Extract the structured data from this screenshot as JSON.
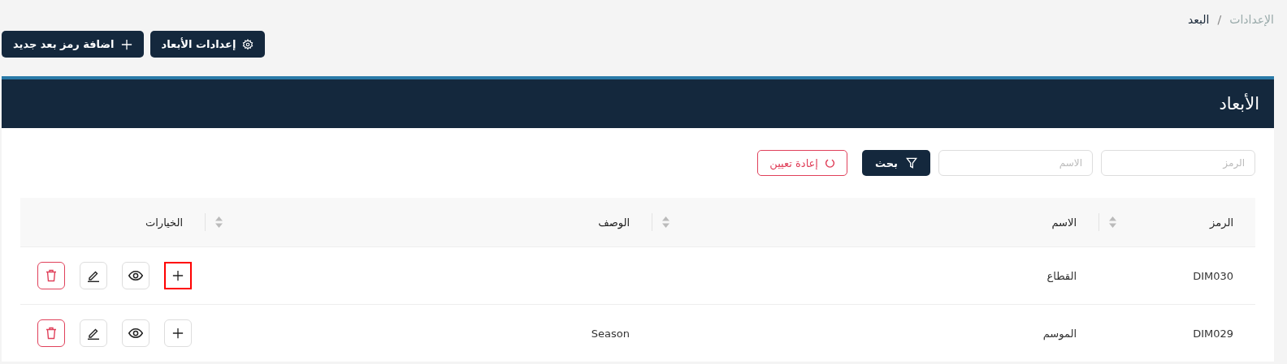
{
  "breadcrumb_separator": "/",
  "breadcrumb": [
    {
      "label": "الإعدادات",
      "current": false
    },
    {
      "label": "البعد",
      "current": true
    }
  ],
  "actions": [
    {
      "kind": "settings",
      "label": "إعدادات الأبعاد"
    },
    {
      "kind": "add",
      "label": "اضافة رمز بعد جديد"
    }
  ],
  "panel": {
    "title": "الأبعاد"
  },
  "filters": {
    "fields": [
      {
        "placeholder": "الرمز"
      },
      {
        "placeholder": "الاسم"
      }
    ],
    "search_button": "بحث",
    "reset_button": "إعادة تعيين"
  },
  "table": {
    "columns": [
      {
        "label": "الرمز",
        "sortable": true
      },
      {
        "label": "الاسم",
        "sortable": true
      },
      {
        "label": "الوصف",
        "sortable": true
      },
      {
        "label": "الخيارات",
        "sortable": false
      }
    ],
    "rows": [
      {
        "code": "DIM030",
        "name": "القطاع",
        "actions": [
          {
            "kind": "add",
            "focused": true
          },
          {
            "kind": "view",
            "focused": false
          },
          {
            "kind": "edit",
            "focused": false
          },
          {
            "kind": "delete",
            "focused": false
          }
        ]
      },
      {
        "code": "DIM029",
        "name": "الموسم",
        "description": "Season",
        "actions": [
          {
            "kind": "add",
            "focused": false
          },
          {
            "kind": "view",
            "focused": false
          },
          {
            "kind": "edit",
            "focused": false
          },
          {
            "kind": "delete",
            "focused": false
          }
        ]
      }
    ]
  }
}
